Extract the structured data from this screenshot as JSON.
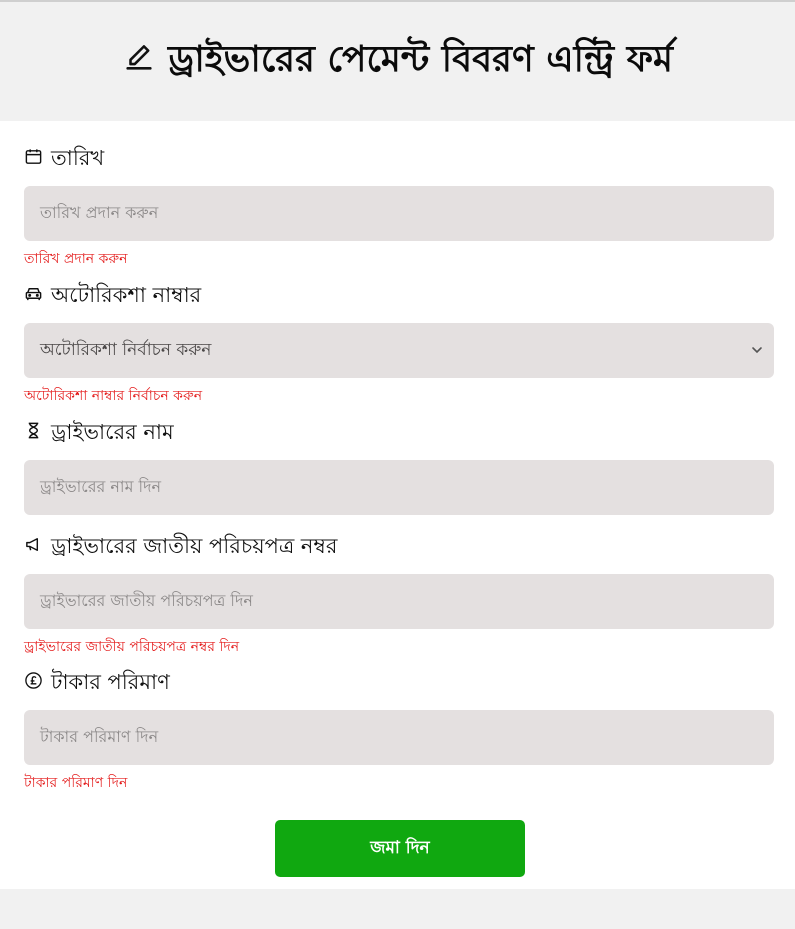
{
  "header": {
    "title": "ড্রাইভারের পেমেন্ট বিবরণ এন্ট্রি ফর্ম",
    "icon": "pencil-icon"
  },
  "fields": {
    "date": {
      "label": "তারিখ",
      "icon": "calendar-icon",
      "placeholder": "তারিখ প্রদান করুন",
      "error": "তারিখ প্রদান করুন"
    },
    "autorickshaw": {
      "label": "অটোরিকশা নাম্বার",
      "icon": "car-icon",
      "selected": "অটোরিকশা নির্বাচন করুন",
      "error": "অটোরিকশা নাম্বার নির্বাচন করুন"
    },
    "driver_name": {
      "label": "ড্রাইভারের নাম",
      "icon": "hourglass-icon",
      "placeholder": "ড্রাইভারের নাম দিন"
    },
    "driver_nid": {
      "label": "ড্রাইভারের জাতীয় পরিচয়পত্র নম্বর",
      "icon": "megaphone-icon",
      "placeholder": "ড্রাইভারের জাতীয় পরিচয়পত্র দিন",
      "error": "ড্রাইভারের জাতীয় পরিচয়পত্র নম্বর দিন"
    },
    "amount": {
      "label": "টাকার পরিমাণ",
      "icon": "pound-coin-icon",
      "placeholder": "টাকার পরিমাণ দিন",
      "error": "টাকার পরিমাণ দিন"
    }
  },
  "submit": {
    "label": "জমা দিন"
  },
  "colors": {
    "error": "#e41b1b",
    "submit": "#10a810",
    "input_bg": "#e4e0e0"
  }
}
